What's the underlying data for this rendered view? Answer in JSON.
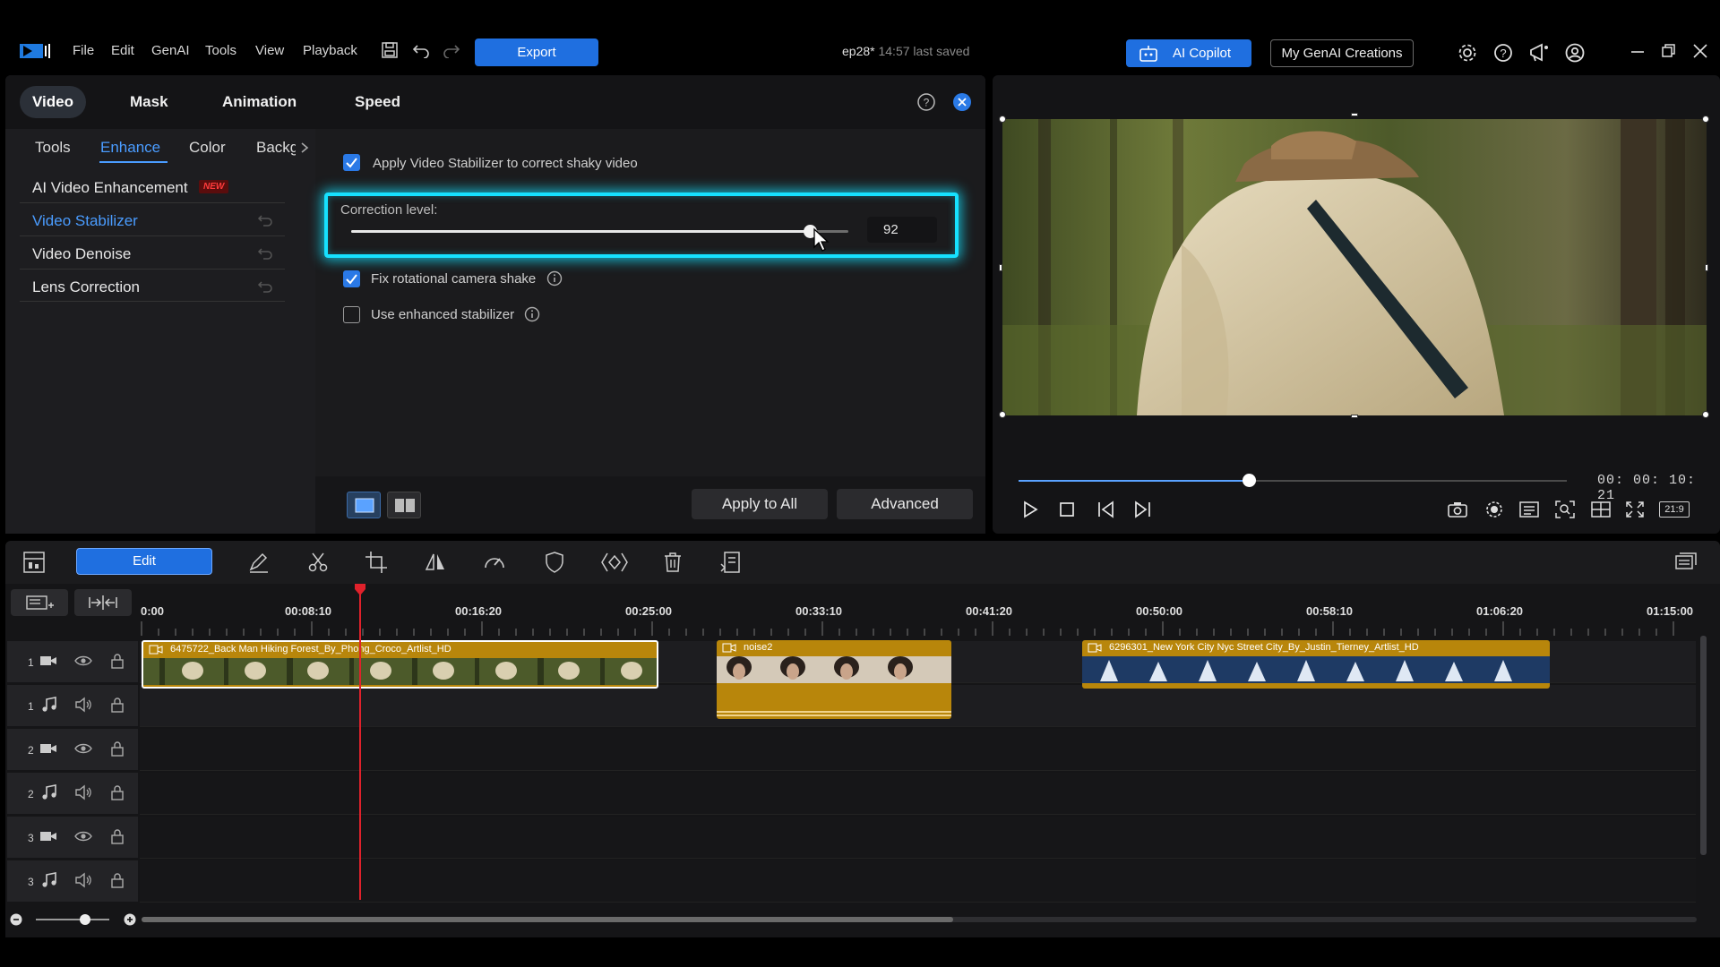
{
  "app": {
    "menu": [
      "File",
      "Edit",
      "GenAI",
      "Tools",
      "View",
      "Playback"
    ],
    "export_label": "Export",
    "project_name": "ep28*",
    "save_status": "14:57 last saved",
    "copilot_label": "AI Copilot",
    "genai_creations_label": "My GenAI Creations"
  },
  "panel": {
    "main_tabs": [
      "Video",
      "Mask",
      "Animation",
      "Speed"
    ],
    "sub_tabs": [
      "Tools",
      "Enhance",
      "Color",
      "Backg"
    ],
    "side_items": [
      "AI Video Enhancement",
      "Video Stabilizer",
      "Video Denoise",
      "Lens Correction"
    ],
    "new_badge": "NEW",
    "apply_stabilizer_label": "Apply Video Stabilizer to correct shaky video",
    "correction_label": "Correction level:",
    "correction_value": "92",
    "correction_fraction": 0.92,
    "fix_rotational_label": "Fix rotational camera shake",
    "enhanced_label": "Use enhanced stabilizer",
    "apply_all_label": "Apply to All",
    "advanced_label": "Advanced"
  },
  "preview": {
    "timecode": "00: 00: 10: 21",
    "progress_fraction": 0.42,
    "aspect_label": "21:9"
  },
  "timeline": {
    "edit_label": "Edit",
    "ruler": [
      "0:00",
      "00:08:10",
      "00:16:20",
      "00:25:00",
      "00:33:10",
      "00:41:20",
      "00:50:00",
      "00:58:10",
      "01:06:20",
      "01:15:00"
    ],
    "tracks": [
      "1",
      "1",
      "2",
      "2",
      "3",
      "3"
    ],
    "clips": {
      "clip1": "6475722_Back Man Hiking Forest_By_Phong_Croco_Artlist_HD",
      "clip2": "noise2",
      "clip3": "6296301_New York City Nyc Street City_By_Justin_Tierney_Artlist_HD"
    }
  },
  "colors": {
    "accent": "#1f6fe0",
    "highlight": "#16e1ff",
    "clip": "#b8860b",
    "playhead": "#e0212b"
  }
}
